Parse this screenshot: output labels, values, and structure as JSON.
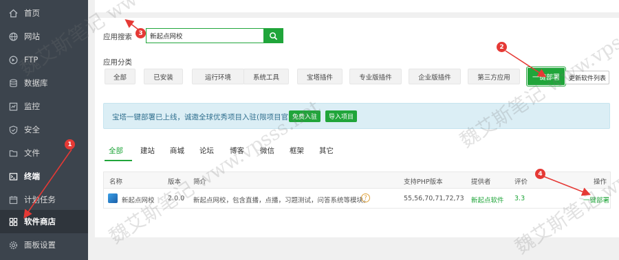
{
  "sidebar": {
    "items": [
      {
        "label": "首页",
        "icon": "home-icon"
      },
      {
        "label": "网站",
        "icon": "globe-icon"
      },
      {
        "label": "FTP",
        "icon": "ftp-icon"
      },
      {
        "label": "数据库",
        "icon": "database-icon"
      },
      {
        "label": "监控",
        "icon": "monitor-icon"
      },
      {
        "label": "安全",
        "icon": "shield-icon"
      },
      {
        "label": "文件",
        "icon": "folder-icon"
      },
      {
        "label": "终端",
        "icon": "terminal-icon"
      },
      {
        "label": "计划任务",
        "icon": "clock-icon"
      },
      {
        "label": "软件商店",
        "icon": "grid-icon"
      },
      {
        "label": "面板设置",
        "icon": "gear-icon"
      }
    ]
  },
  "search": {
    "label": "应用搜索",
    "value": "新起点网校"
  },
  "category": {
    "label": "应用分类",
    "buttons": [
      "全部",
      "已安装",
      "运行环境",
      "系统工具",
      "宝塔插件",
      "专业版插件",
      "企业版插件",
      "第三方应用"
    ],
    "one_click_label": "一键部署",
    "refresh_label": "更新软件列表"
  },
  "notice": {
    "text": "宝塔一键部署已上线，诚邀全球优秀项目入驻(限项目官方)",
    "free_label": "免费入驻",
    "import_label": "导入项目"
  },
  "tabs": [
    "全部",
    "建站",
    "商城",
    "论坛",
    "博客",
    "微信",
    "框架",
    "其它"
  ],
  "table": {
    "headers": [
      "名称",
      "版本",
      "简介",
      "支持PHP版本",
      "提供者",
      "评价",
      "操作"
    ],
    "row": {
      "name": "新起点网校",
      "version": "2.0.0",
      "desc": "新起点网校，包含直播，点播，习题测试，问答系统等模块。",
      "help": "?",
      "php": "55,56,70,71,72,73",
      "provider": "新起点软件",
      "rating": "3.3",
      "action": "一键部署"
    }
  },
  "annotations": [
    "1",
    "2",
    "3",
    "4"
  ],
  "watermarks": [
    "魏艾斯笔记 www.vpsss.net"
  ],
  "colors": {
    "accent": "#20a53a",
    "sidebar": "#3c444d",
    "marker": "#e53935",
    "notice_bg": "#dbeef5"
  }
}
